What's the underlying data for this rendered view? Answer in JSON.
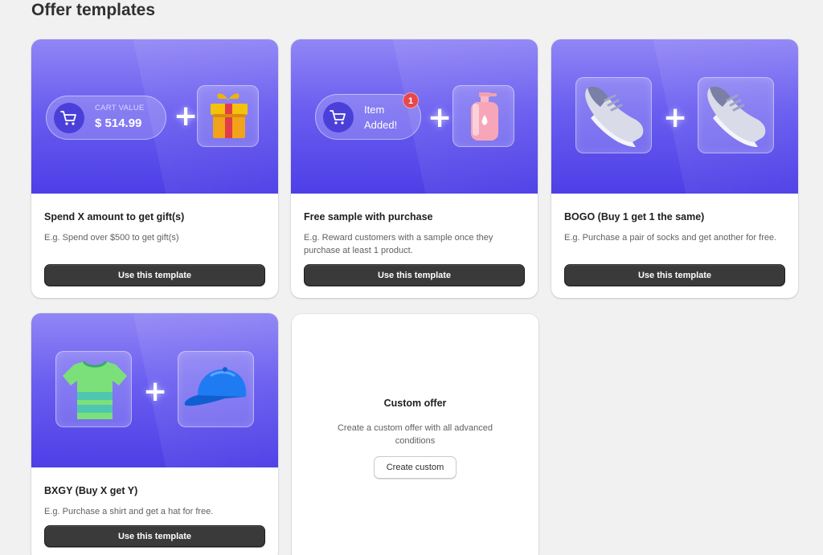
{
  "page": {
    "title": "Offer templates"
  },
  "templates": [
    {
      "title": "Spend X amount to get gift(s)",
      "description": "E.g. Spend over $500 to get gift(s)",
      "button_label": "Use this template",
      "banner": {
        "cart_label": "CART VALUE",
        "cart_value": "$ 514.99",
        "plus": "+",
        "icons": [
          "cart-icon",
          "gift-icon"
        ]
      }
    },
    {
      "title": "Free sample with purchase",
      "description": "E.g. Reward customers with a sample once they purchase at least 1 product.",
      "button_label": "Use this template",
      "banner": {
        "item_line1": "Item",
        "item_line2": "Added!",
        "badge": "1",
        "plus": "+",
        "icons": [
          "cart-icon",
          "lotion-bottle-icon"
        ]
      }
    },
    {
      "title": "BOGO (Buy 1 get 1 the same)",
      "description": "E.g. Purchase a pair of socks and get another for free.",
      "button_label": "Use this template",
      "banner": {
        "plus": "+",
        "icons": [
          "sneaker-icon",
          "sneaker-icon"
        ]
      }
    },
    {
      "title": "BXGY (Buy X get Y)",
      "description": "E.g. Purchase a shirt and get a hat for free.",
      "button_label": "Use this template",
      "banner": {
        "plus": "+",
        "icons": [
          "tshirt-icon",
          "cap-icon"
        ]
      }
    }
  ],
  "custom_offer": {
    "title": "Custom offer",
    "description": "Create a custom offer with all advanced conditions",
    "button_label": "Create custom"
  },
  "colors": {
    "banner_top": "#9186f5",
    "banner_bottom": "#4d3fe6",
    "button_dark": "#3a3a3a",
    "badge": "#e5484d"
  }
}
